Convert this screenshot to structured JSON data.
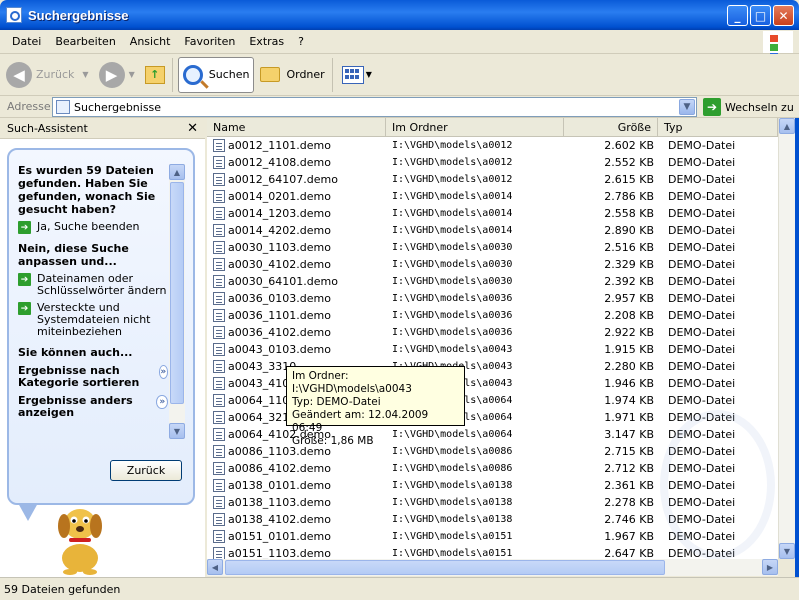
{
  "window": {
    "title": "Suchergebnisse"
  },
  "menu": [
    "Datei",
    "Bearbeiten",
    "Ansicht",
    "Favoriten",
    "Extras",
    "?"
  ],
  "toolbar": {
    "back": "Zurück",
    "search": "Suchen",
    "folders": "Ordner"
  },
  "address": {
    "label": "Adresse",
    "value": "Suchergebnisse",
    "go": "Wechseln zu"
  },
  "pane": {
    "title": "Such-Assistent",
    "question": "Es wurden 59 Dateien gefunden. Haben Sie gefunden, wonach Sie gesucht haben?",
    "opt_done": "Ja, Suche beenden",
    "refine_head": "Nein, diese Suche anpassen und...",
    "opt_names": "Dateinamen oder Schlüsselwörter ändern",
    "opt_hidden": "Versteckte und Systemdateien nicht miteinbeziehen",
    "can_head": "Sie können auch...",
    "sort": "Ergebnisse nach Kategorie sortieren",
    "show": "Ergebnisse anders anzeigen",
    "back_button": "Zurück"
  },
  "columns": {
    "name": "Name",
    "folder": "Im Ordner",
    "size": "Größe",
    "type": "Typ"
  },
  "files": [
    {
      "name": "a0012_1101.demo",
      "folder": "I:\\VGHD\\models\\a0012",
      "size": "2.602 KB",
      "type": "DEMO-Datei"
    },
    {
      "name": "a0012_4108.demo",
      "folder": "I:\\VGHD\\models\\a0012",
      "size": "2.552 KB",
      "type": "DEMO-Datei"
    },
    {
      "name": "a0012_64107.demo",
      "folder": "I:\\VGHD\\models\\a0012",
      "size": "2.615 KB",
      "type": "DEMO-Datei"
    },
    {
      "name": "a0014_0201.demo",
      "folder": "I:\\VGHD\\models\\a0014",
      "size": "2.786 KB",
      "type": "DEMO-Datei"
    },
    {
      "name": "a0014_1203.demo",
      "folder": "I:\\VGHD\\models\\a0014",
      "size": "2.558 KB",
      "type": "DEMO-Datei"
    },
    {
      "name": "a0014_4202.demo",
      "folder": "I:\\VGHD\\models\\a0014",
      "size": "2.890 KB",
      "type": "DEMO-Datei"
    },
    {
      "name": "a0030_1103.demo",
      "folder": "I:\\VGHD\\models\\a0030",
      "size": "2.516 KB",
      "type": "DEMO-Datei"
    },
    {
      "name": "a0030_4102.demo",
      "folder": "I:\\VGHD\\models\\a0030",
      "size": "2.329 KB",
      "type": "DEMO-Datei"
    },
    {
      "name": "a0030_64101.demo",
      "folder": "I:\\VGHD\\models\\a0030",
      "size": "2.392 KB",
      "type": "DEMO-Datei"
    },
    {
      "name": "a0036_0103.demo",
      "folder": "I:\\VGHD\\models\\a0036",
      "size": "2.957 KB",
      "type": "DEMO-Datei"
    },
    {
      "name": "a0036_1101.demo",
      "folder": "I:\\VGHD\\models\\a0036",
      "size": "2.208 KB",
      "type": "DEMO-Datei"
    },
    {
      "name": "a0036_4102.demo",
      "folder": "I:\\VGHD\\models\\a0036",
      "size": "2.922 KB",
      "type": "DEMO-Datei"
    },
    {
      "name": "a0043_0103.demo",
      "folder": "I:\\VGHD\\models\\a0043",
      "size": "1.915 KB",
      "type": "DEMO-Datei"
    },
    {
      "name": "a0043_3310",
      "folder": "I:\\VGHD\\models\\a0043",
      "size": "2.280 KB",
      "type": "DEMO-Datei"
    },
    {
      "name": "a0043_4102",
      "folder": "I:\\VGHD\\models\\a0043",
      "size": "1.946 KB",
      "type": "DEMO-Datei"
    },
    {
      "name": "a0064_1101",
      "folder": "I:\\VGHD\\models\\a0064",
      "size": "1.974 KB",
      "type": "DEMO-Datei"
    },
    {
      "name": "a0064_3210",
      "folder": "I:\\VGHD\\models\\a0064",
      "size": "1.971 KB",
      "type": "DEMO-Datei"
    },
    {
      "name": "a0064_4102.demo",
      "folder": "I:\\VGHD\\models\\a0064",
      "size": "3.147 KB",
      "type": "DEMO-Datei"
    },
    {
      "name": "a0086_1103.demo",
      "folder": "I:\\VGHD\\models\\a0086",
      "size": "2.715 KB",
      "type": "DEMO-Datei"
    },
    {
      "name": "a0086_4102.demo",
      "folder": "I:\\VGHD\\models\\a0086",
      "size": "2.712 KB",
      "type": "DEMO-Datei"
    },
    {
      "name": "a0138_0101.demo",
      "folder": "I:\\VGHD\\models\\a0138",
      "size": "2.361 KB",
      "type": "DEMO-Datei"
    },
    {
      "name": "a0138_1103.demo",
      "folder": "I:\\VGHD\\models\\a0138",
      "size": "2.278 KB",
      "type": "DEMO-Datei"
    },
    {
      "name": "a0138_4102.demo",
      "folder": "I:\\VGHD\\models\\a0138",
      "size": "2.746 KB",
      "type": "DEMO-Datei"
    },
    {
      "name": "a0151_0101.demo",
      "folder": "I:\\VGHD\\models\\a0151",
      "size": "1.967 KB",
      "type": "DEMO-Datei"
    },
    {
      "name": "a0151_1103.demo",
      "folder": "I:\\VGHD\\models\\a0151",
      "size": "2.647 KB",
      "type": "DEMO-Datei"
    }
  ],
  "tooltip": {
    "folder": "Im Ordner: I:\\VGHD\\models\\a0043",
    "type": "Typ: DEMO-Datei",
    "modified": "Geändert am: 12.04.2009 06:49",
    "size": "Größe: 1,86 MB"
  },
  "status": "59 Dateien gefunden"
}
